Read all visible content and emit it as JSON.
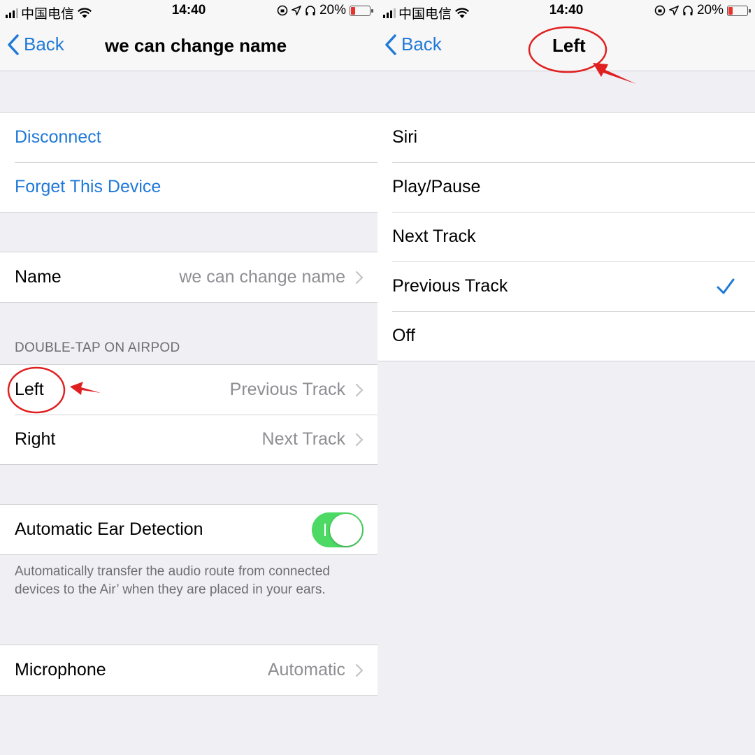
{
  "left_screen": {
    "status": {
      "carrier": "中国电信",
      "time": "14:40",
      "battery": "20%",
      "battery_level": 0.2
    },
    "nav": {
      "back_label": "Back",
      "title": "we can change name"
    },
    "actions": [
      {
        "label": "Disconnect"
      },
      {
        "label": "Forget This Device"
      }
    ],
    "name_row": {
      "label": "Name",
      "value": "we can change name"
    },
    "double_tap": {
      "header": "DOUBLE-TAP ON AIRPOD",
      "rows": [
        {
          "label": "Left",
          "value": "Previous Track"
        },
        {
          "label": "Right",
          "value": "Next Track"
        }
      ]
    },
    "ear_detection": {
      "label": "Automatic Ear Detection",
      "enabled": true,
      "footer": "Automatically transfer the audio route from connected devices to the Air’       when they are placed in your ears."
    },
    "microphone": {
      "label": "Microphone",
      "value": "Automatic"
    }
  },
  "right_screen": {
    "status": {
      "carrier": "中国电信",
      "time": "14:40",
      "battery": "20%",
      "battery_level": 0.2
    },
    "nav": {
      "back_label": "Back",
      "title": "Left"
    },
    "options": [
      {
        "label": "Siri",
        "selected": false
      },
      {
        "label": "Play/Pause",
        "selected": false
      },
      {
        "label": "Next Track",
        "selected": false
      },
      {
        "label": "Previous Track",
        "selected": true
      },
      {
        "label": "Off",
        "selected": false
      }
    ]
  },
  "colors": {
    "ios_blue": "#2079d8",
    "toggle_green": "#4cd964",
    "annotation_red": "#e02020",
    "background": "#efeff4"
  }
}
